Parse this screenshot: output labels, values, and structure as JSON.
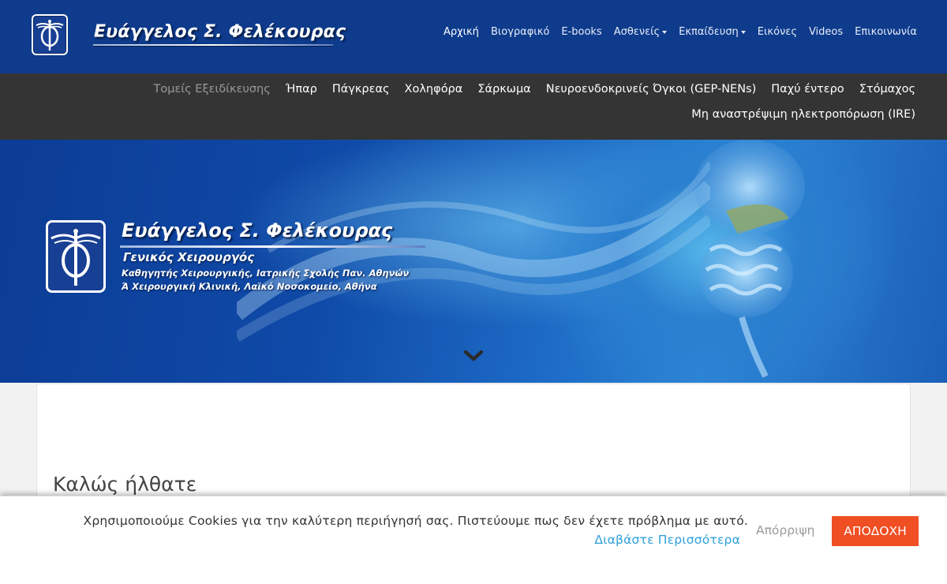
{
  "brand": {
    "name": "Ευάγγελος Σ. Φελέκουρας",
    "logo_icon": "caduceus-phi-icon"
  },
  "nav": {
    "items": [
      {
        "label": "Αρχική",
        "active": true,
        "dropdown": false
      },
      {
        "label": "Βιογραφικό",
        "active": false,
        "dropdown": false
      },
      {
        "label": "E-books",
        "active": false,
        "dropdown": false
      },
      {
        "label": "Ασθενείς",
        "active": false,
        "dropdown": true
      },
      {
        "label": "Εκπαίδευση",
        "active": false,
        "dropdown": true
      },
      {
        "label": "Εικόνες",
        "active": false,
        "dropdown": false
      },
      {
        "label": "Videos",
        "active": false,
        "dropdown": false
      },
      {
        "label": "Επικοινωνία",
        "active": false,
        "dropdown": false
      }
    ]
  },
  "specialties": {
    "title": "Τομείς Εξειδίκευσης",
    "row1": [
      "Ήπαρ",
      "Πάγκρεας",
      "Χοληφόρα",
      "Σάρκωμα",
      "Νευροενδοκρινείς Όγκοι (GEP-NENs)",
      "Παχύ έντερο",
      "Στόμαχος"
    ],
    "row2": [
      "Μη αναστρέψιμη ηλεκτροπόρωση (IRE)"
    ]
  },
  "hero": {
    "title": "Ευάγγελος Σ. Φελέκουρας",
    "subtitle": "Γενικός Χειρουργός",
    "line3": "Καθηγητής Χειρουργικής, Ιατρικής Σχολής Παν. Αθηνών",
    "line4": "Ά Χειρουργική Κλινική, Λαϊκό Νοσοκομείο, Αθήνα",
    "scroll_icon": "chevron-down-icon"
  },
  "content": {
    "welcome": "Καλώς ήλθατε"
  },
  "cookie": {
    "text": "Χρησιμοποιούμε Cookies για την καλύτερη περιήγησή σας. Πιστεύουμε πως δεν έχετε πρόβλημα με αυτό.",
    "link": "Διαβάστε Περισσότερα",
    "reject": "Απόρριψη",
    "accept": "ΑΠΟΔΟΧΗ"
  },
  "colors": {
    "navbar": "#0e3b8c",
    "specbar": "#343434",
    "accept_button": "#f04e23",
    "link": "#2d9fd8"
  }
}
